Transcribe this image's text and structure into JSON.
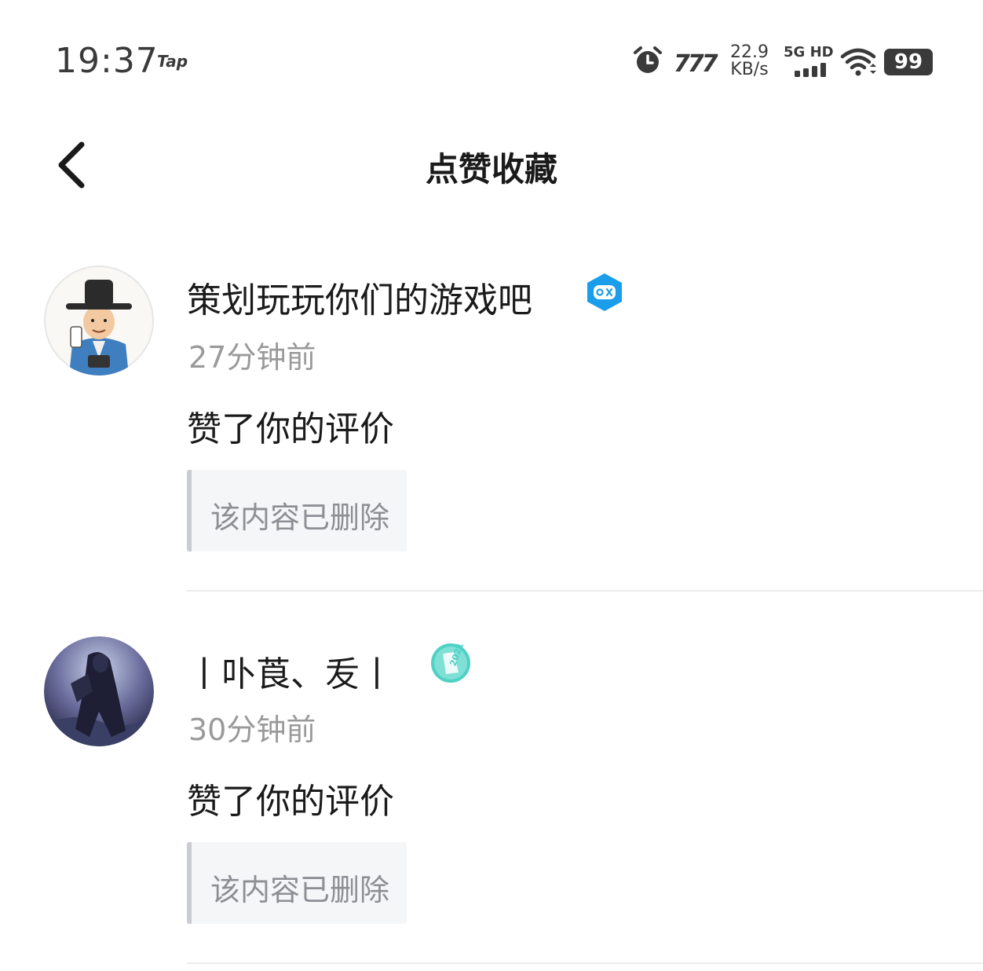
{
  "status_bar": {
    "time": "19:37",
    "app_badge": "Tap",
    "carrier_logo": "777",
    "net_speed_value": "22.9",
    "net_speed_unit": "KB/s",
    "network_type": "5G HD",
    "battery": "99",
    "icons": [
      "alarm-icon",
      "signal-icon",
      "wifi-icon",
      "battery-icon"
    ]
  },
  "header": {
    "title": "点赞收藏",
    "back_icon": "chevron-left-icon"
  },
  "notifications": [
    {
      "username": "策划玩玩你们的游戏吧",
      "badge_icon": "gamepad-badge-icon",
      "time": "27分钟前",
      "action": "赞了你的评价",
      "quote": "该内容已删除"
    },
    {
      "username": "丨卟莨、叐丨",
      "badge_icon": "2021-badge-icon",
      "time": "30分钟前",
      "action": "赞了你的评价",
      "quote": "该内容已删除"
    }
  ],
  "colors": {
    "text_primary": "#1a1a1a",
    "text_secondary": "#9a9a9a",
    "quote_bg": "#f5f6f7",
    "quote_border": "#c9ccd1",
    "badge_blue": "#1a9dea",
    "badge_teal": "#4fd1c5"
  }
}
